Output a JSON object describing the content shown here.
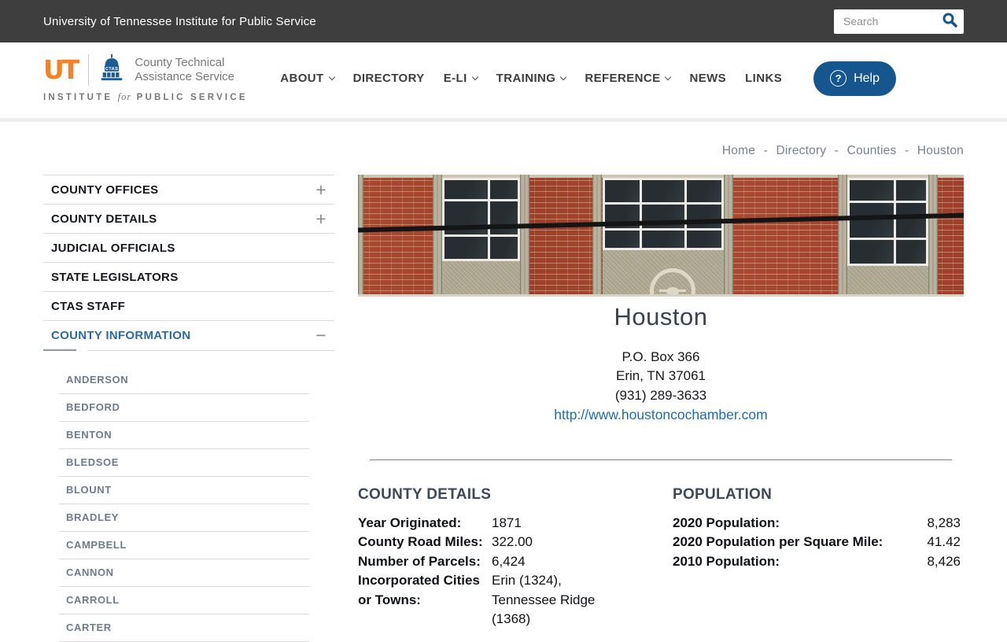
{
  "colors": {
    "topbar_bg": "#3e3e3e",
    "help_button_blue": "#15568e",
    "link_blue": "#1b6db5",
    "active_sidebar_blue": "#2a6aa3",
    "ut_orange": "#f58025",
    "brick_red": "#a6462e"
  },
  "topbar": {
    "title": "University of Tennessee Institute for Public Service",
    "search_placeholder": "Search"
  },
  "header": {
    "logo": {
      "ut_mark": "UT",
      "ctas_acronym": "CTAS",
      "org_line1": "County Technical",
      "org_line2": "Assistance Service",
      "institute_pre": "INSTITUTE",
      "institute_for": "for",
      "institute_post": "PUBLIC SERVICE"
    },
    "nav": [
      "ABOUT",
      "DIRECTORY",
      "E-LI",
      "TRAINING",
      "REFERENCE",
      "NEWS",
      "LINKS"
    ],
    "help_label": "Help",
    "help_icon": "?"
  },
  "breadcrumb": {
    "items": [
      "Home",
      "Directory",
      "Counties",
      "Houston"
    ],
    "separator": "-"
  },
  "sidebar": {
    "sections": [
      {
        "label": "COUNTY OFFICES",
        "toggle": "+"
      },
      {
        "label": "COUNTY DETAILS",
        "toggle": "+"
      },
      {
        "label": "JUDICIAL OFFICIALS",
        "toggle": ""
      },
      {
        "label": "STATE LEGISLATORS",
        "toggle": ""
      },
      {
        "label": "CTAS STAFF",
        "toggle": ""
      },
      {
        "label": "COUNTY INFORMATION",
        "toggle": "−"
      }
    ],
    "counties": [
      "ANDERSON",
      "BEDFORD",
      "BENTON",
      "BLEDSOE",
      "BLOUNT",
      "BRADLEY",
      "CAMPBELL",
      "CANNON",
      "CARROLL",
      "CARTER"
    ]
  },
  "county": {
    "name": "Houston",
    "address_line1": "P.O. Box 366",
    "address_line2": "Erin, TN 37061",
    "phone": "(931) 289-3633",
    "website": "http://www.houstoncochamber.com"
  },
  "details": {
    "heading": "COUNTY DETAILS",
    "rows": [
      {
        "label": "Year Originated:",
        "value": "1871"
      },
      {
        "label": "County Road Miles:",
        "value": "322.00"
      },
      {
        "label": "Number of Parcels:",
        "value": "6,424"
      },
      {
        "label": "Incorporated Cities or Towns:",
        "value": "Erin (1324), Tennessee Ridge (1368)"
      }
    ]
  },
  "population": {
    "heading": "POPULATION",
    "rows": [
      {
        "label": "2020 Population:",
        "value": "8,283"
      },
      {
        "label": "2020 Population per Square Mile:",
        "value": "41.42"
      },
      {
        "label": "2010 Population:",
        "value": "8,426"
      }
    ]
  }
}
